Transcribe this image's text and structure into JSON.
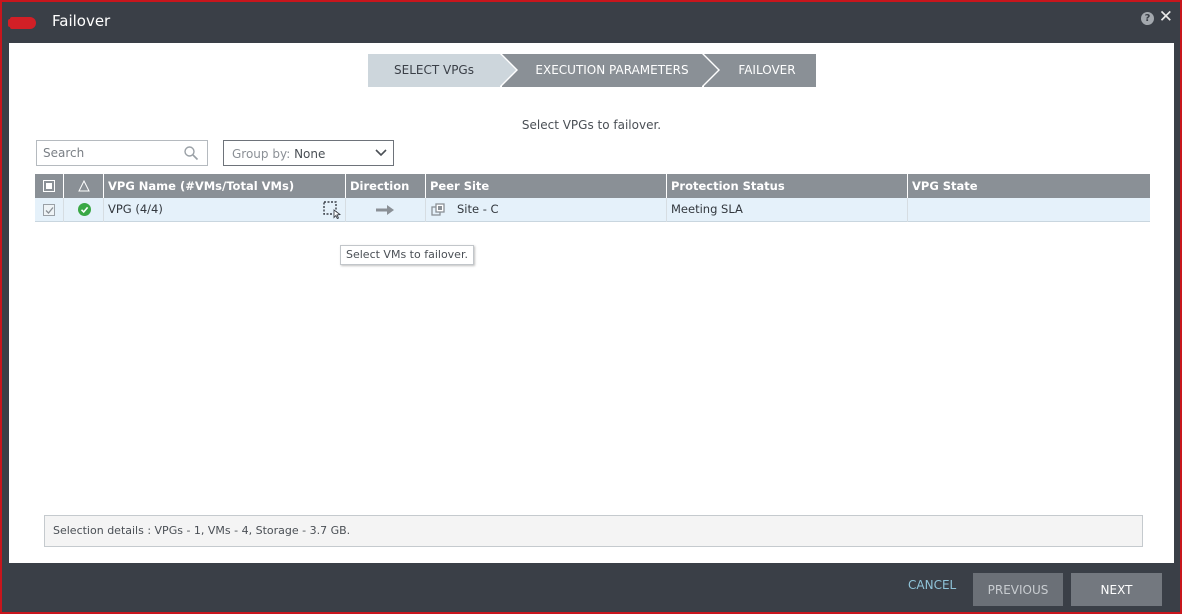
{
  "window": {
    "title": "Failover",
    "help_icon_glyph": "?",
    "close_icon_glyph": "✕"
  },
  "wizard": {
    "steps": [
      {
        "label": "SELECT VPGs",
        "active": true
      },
      {
        "label": "EXECUTION PARAMETERS",
        "active": false
      },
      {
        "label": "FAILOVER",
        "active": false
      }
    ]
  },
  "instruction": "Select VPGs to failover.",
  "search": {
    "placeholder": "Search"
  },
  "group_by": {
    "label": "Group by:",
    "value": "None"
  },
  "table": {
    "columns": [
      "VPG Name (#VMs/Total VMs)",
      "Direction",
      "Peer Site",
      "Protection Status",
      "VPG State"
    ],
    "rows": [
      {
        "checked": true,
        "status_icon": "check-circle-icon",
        "vpg_name": "VPG (4/4)",
        "direction_icon": "arrow-right-icon",
        "peer_site": "Site - C",
        "protection_status": "Meeting SLA",
        "vpg_state": ""
      }
    ]
  },
  "tooltip": "Select VMs to failover.",
  "selection_details": "Selection details :  VPGs  -  1, VMs  -  4, Storage  -  3.7 GB.",
  "footer": {
    "cancel": "CANCEL",
    "previous": "PREVIOUS",
    "next": "NEXT"
  },
  "colors": {
    "frame_border": "#c8161d",
    "header_bg": "#3a3f47",
    "table_header": "#8a9096",
    "row_selected": "#e5f1fa",
    "status_ok": "#3aa845",
    "cancel_link": "#8fc3d8"
  }
}
